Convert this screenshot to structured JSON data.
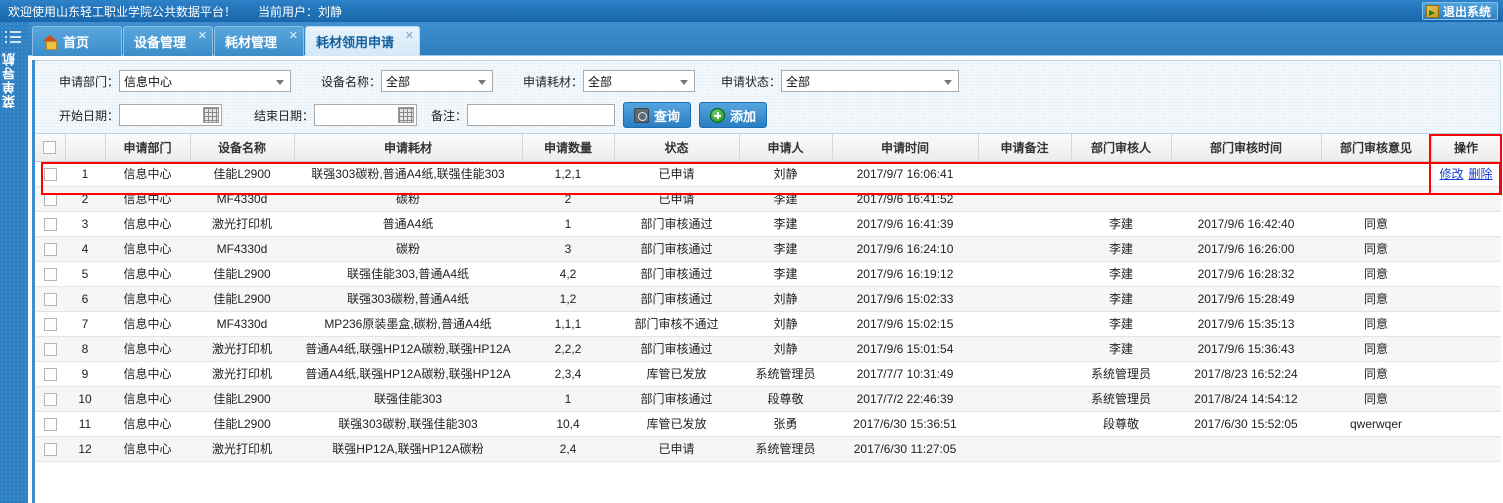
{
  "topbar": {
    "welcome": "欢迎使用山东轻工职业学院公共数据平台！",
    "user": "当前用户：刘静",
    "logout_label": "退出系统",
    "logout_icon": "exit-door-icon"
  },
  "rail": {
    "menu_icon": "list-menu-icon",
    "label": "菜单导航"
  },
  "tabs": [
    {
      "label": "首页",
      "icon": "home-icon",
      "active": false,
      "closable": false
    },
    {
      "label": "设备管理",
      "active": false,
      "closable": true
    },
    {
      "label": "耗材管理",
      "active": false,
      "closable": true
    },
    {
      "label": "耗材领用申请",
      "active": true,
      "closable": true
    }
  ],
  "filter": {
    "dept_label": "申请部门：",
    "dept_value": "信息中心",
    "device_label": "设备名称：",
    "device_value": "全部",
    "consumable_label": "申请耗材：",
    "consumable_value": "全部",
    "status_label": "申请状态：",
    "status_value": "全部",
    "start_date_label": "开始日期：",
    "start_date_value": "",
    "end_date_label": "结束日期：",
    "end_date_value": "",
    "remark_label": "备注：",
    "remark_value": "",
    "query_button": "查询",
    "add_button": "添加"
  },
  "table": {
    "columns": [
      "",
      "",
      "申请部门",
      "设备名称",
      "申请耗材",
      "申请数量",
      "状态",
      "申请人",
      "申请时间",
      "申请备注",
      "部门审核人",
      "部门审核时间",
      "部门审核意见",
      "操作"
    ],
    "action_edit": "修改",
    "action_delete": "删除",
    "rows": [
      {
        "no": "1",
        "dept": "信息中心",
        "device": "佳能L2900",
        "consumable": "联强303碳粉,普通A4纸,联强佳能303",
        "qty": "1,2,1",
        "status": "已申请",
        "applicant": "刘静",
        "apply_time": "2017/9/7 16:06:41",
        "apply_remark": "",
        "auditor": "",
        "audit_time": "",
        "audit_opinion": "",
        "has_actions": true
      },
      {
        "no": "2",
        "dept": "信息中心",
        "device": "MF4330d",
        "consumable": "碳粉",
        "qty": "2",
        "status": "已申请",
        "applicant": "李建",
        "apply_time": "2017/9/6 16:41:52",
        "apply_remark": "",
        "auditor": "",
        "audit_time": "",
        "audit_opinion": "",
        "has_actions": false
      },
      {
        "no": "3",
        "dept": "信息中心",
        "device": "激光打印机",
        "consumable": "普通A4纸",
        "qty": "1",
        "status": "部门审核通过",
        "applicant": "李建",
        "apply_time": "2017/9/6 16:41:39",
        "apply_remark": "",
        "auditor": "李建",
        "audit_time": "2017/9/6 16:42:40",
        "audit_opinion": "同意",
        "has_actions": false
      },
      {
        "no": "4",
        "dept": "信息中心",
        "device": "MF4330d",
        "consumable": "碳粉",
        "qty": "3",
        "status": "部门审核通过",
        "applicant": "李建",
        "apply_time": "2017/9/6 16:24:10",
        "apply_remark": "",
        "auditor": "李建",
        "audit_time": "2017/9/6 16:26:00",
        "audit_opinion": "同意",
        "has_actions": false
      },
      {
        "no": "5",
        "dept": "信息中心",
        "device": "佳能L2900",
        "consumable": "联强佳能303,普通A4纸",
        "qty": "4,2",
        "status": "部门审核通过",
        "applicant": "李建",
        "apply_time": "2017/9/6 16:19:12",
        "apply_remark": "",
        "auditor": "李建",
        "audit_time": "2017/9/6 16:28:32",
        "audit_opinion": "同意",
        "has_actions": false
      },
      {
        "no": "6",
        "dept": "信息中心",
        "device": "佳能L2900",
        "consumable": "联强303碳粉,普通A4纸",
        "qty": "1,2",
        "status": "部门审核通过",
        "applicant": "刘静",
        "apply_time": "2017/9/6 15:02:33",
        "apply_remark": "",
        "auditor": "李建",
        "audit_time": "2017/9/6 15:28:49",
        "audit_opinion": "同意",
        "has_actions": false
      },
      {
        "no": "7",
        "dept": "信息中心",
        "device": "MF4330d",
        "consumable": "MP236原装墨盒,碳粉,普通A4纸",
        "qty": "1,1,1",
        "status": "部门审核不通过",
        "applicant": "刘静",
        "apply_time": "2017/9/6 15:02:15",
        "apply_remark": "",
        "auditor": "李建",
        "audit_time": "2017/9/6 15:35:13",
        "audit_opinion": "同意",
        "has_actions": false
      },
      {
        "no": "8",
        "dept": "信息中心",
        "device": "激光打印机",
        "consumable": "普通A4纸,联强HP12A碳粉,联强HP12A",
        "qty": "2,2,2",
        "status": "部门审核通过",
        "applicant": "刘静",
        "apply_time": "2017/9/6 15:01:54",
        "apply_remark": "",
        "auditor": "李建",
        "audit_time": "2017/9/6 15:36:43",
        "audit_opinion": "同意",
        "has_actions": false
      },
      {
        "no": "9",
        "dept": "信息中心",
        "device": "激光打印机",
        "consumable": "普通A4纸,联强HP12A碳粉,联强HP12A",
        "qty": "2,3,4",
        "status": "库管已发放",
        "applicant": "系统管理员",
        "apply_time": "2017/7/7 10:31:49",
        "apply_remark": "",
        "auditor": "系统管理员",
        "audit_time": "2017/8/23 16:52:24",
        "audit_opinion": "同意",
        "has_actions": false
      },
      {
        "no": "10",
        "dept": "信息中心",
        "device": "佳能L2900",
        "consumable": "联强佳能303",
        "qty": "1",
        "status": "部门审核通过",
        "applicant": "段尊敬",
        "apply_time": "2017/7/2 22:46:39",
        "apply_remark": "",
        "auditor": "系统管理员",
        "audit_time": "2017/8/24 14:54:12",
        "audit_opinion": "同意",
        "has_actions": false
      },
      {
        "no": "11",
        "dept": "信息中心",
        "device": "佳能L2900",
        "consumable": "联强303碳粉,联强佳能303",
        "qty": "10,4",
        "status": "库管已发放",
        "applicant": "张勇",
        "apply_time": "2017/6/30 15:36:51",
        "apply_remark": "",
        "auditor": "段尊敬",
        "audit_time": "2017/6/30 15:52:05",
        "audit_opinion": "qwerwqer",
        "has_actions": false
      },
      {
        "no": "12",
        "dept": "信息中心",
        "device": "激光打印机",
        "consumable": "联强HP12A,联强HP12A碳粉",
        "qty": "2,4",
        "status": "已申请",
        "applicant": "系统管理员",
        "apply_time": "2017/6/30 11:27:05",
        "apply_remark": "",
        "auditor": "",
        "audit_time": "",
        "audit_opinion": "",
        "has_actions": false
      }
    ]
  },
  "annotations": {
    "highlight_color": "#ff0000"
  }
}
